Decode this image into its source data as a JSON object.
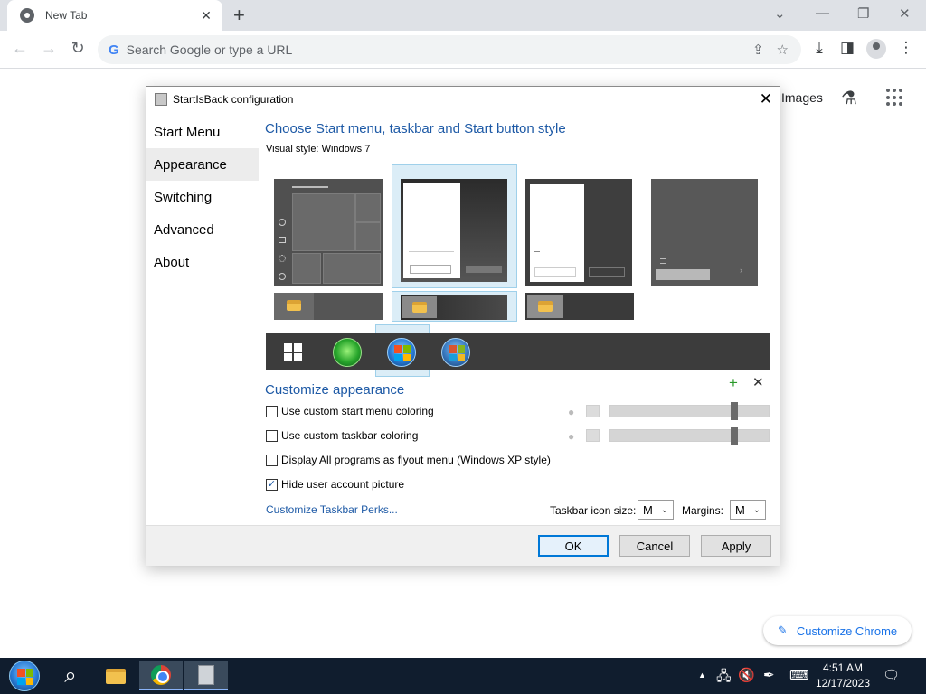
{
  "browser": {
    "tab_title": "New Tab",
    "tab_close": "✕",
    "new_tab": "+",
    "win_controls": {
      "tablist": "⌄",
      "minimize": "—",
      "restore": "❐",
      "close": "✕"
    },
    "nav": {
      "back": "←",
      "forward": "→",
      "reload": "↻"
    },
    "omnibox": {
      "google_glyph": "G",
      "placeholder": "Search Google or type a URL",
      "share": "⇪",
      "bookmark": "☆"
    },
    "toolbar_icons": {
      "download": "⤓",
      "side_panel": "◨",
      "menu": "⋮"
    }
  },
  "newtab": {
    "images_link": "Images",
    "labs_icon": "⚗",
    "customize_chrome": "Customize Chrome",
    "customize_pencil": "✎"
  },
  "dialog": {
    "title": "StartIsBack configuration",
    "close": "✕",
    "sidebar": [
      {
        "label": "Start Menu",
        "active": false
      },
      {
        "label": "Appearance",
        "active": true
      },
      {
        "label": "Switching",
        "active": false
      },
      {
        "label": "Advanced",
        "active": false
      },
      {
        "label": "About",
        "active": false
      }
    ],
    "heading": "Choose Start menu, taskbar and Start button style",
    "visual_style_label": "Visual style:",
    "visual_style_value": "Windows 7",
    "customize_heading": "Customize appearance",
    "add_icon": "+",
    "remove_icon": "✕",
    "checkboxes": [
      {
        "label": "Use custom start menu coloring",
        "checked": false
      },
      {
        "label": "Use custom taskbar coloring",
        "checked": false
      },
      {
        "label": "Display All programs as flyout menu (Windows XP style)",
        "checked": false
      },
      {
        "label": "Hide user account picture",
        "checked": true
      }
    ],
    "check_mark": "✓",
    "drop_glyph": "●",
    "sliders": {
      "start_menu_level": 0.78,
      "taskbar_level": 0.78
    },
    "perks_link": "Customize Taskbar Perks...",
    "icon_size_label": "Taskbar icon size:",
    "icon_size_value": "M",
    "margins_label": "Margins:",
    "margins_value": "M",
    "combo_chevron": "⌄",
    "buttons": {
      "ok": "OK",
      "cancel": "Cancel",
      "apply": "Apply"
    }
  },
  "taskbar": {
    "search_glyph": "⌕",
    "tray": {
      "chevron": "▲",
      "network": "🖧",
      "volume": "🔇",
      "pen": "✒",
      "keyboard": "⌨",
      "notification": "🗨"
    },
    "time": "4:51 AM",
    "date": "12/17/2023"
  }
}
